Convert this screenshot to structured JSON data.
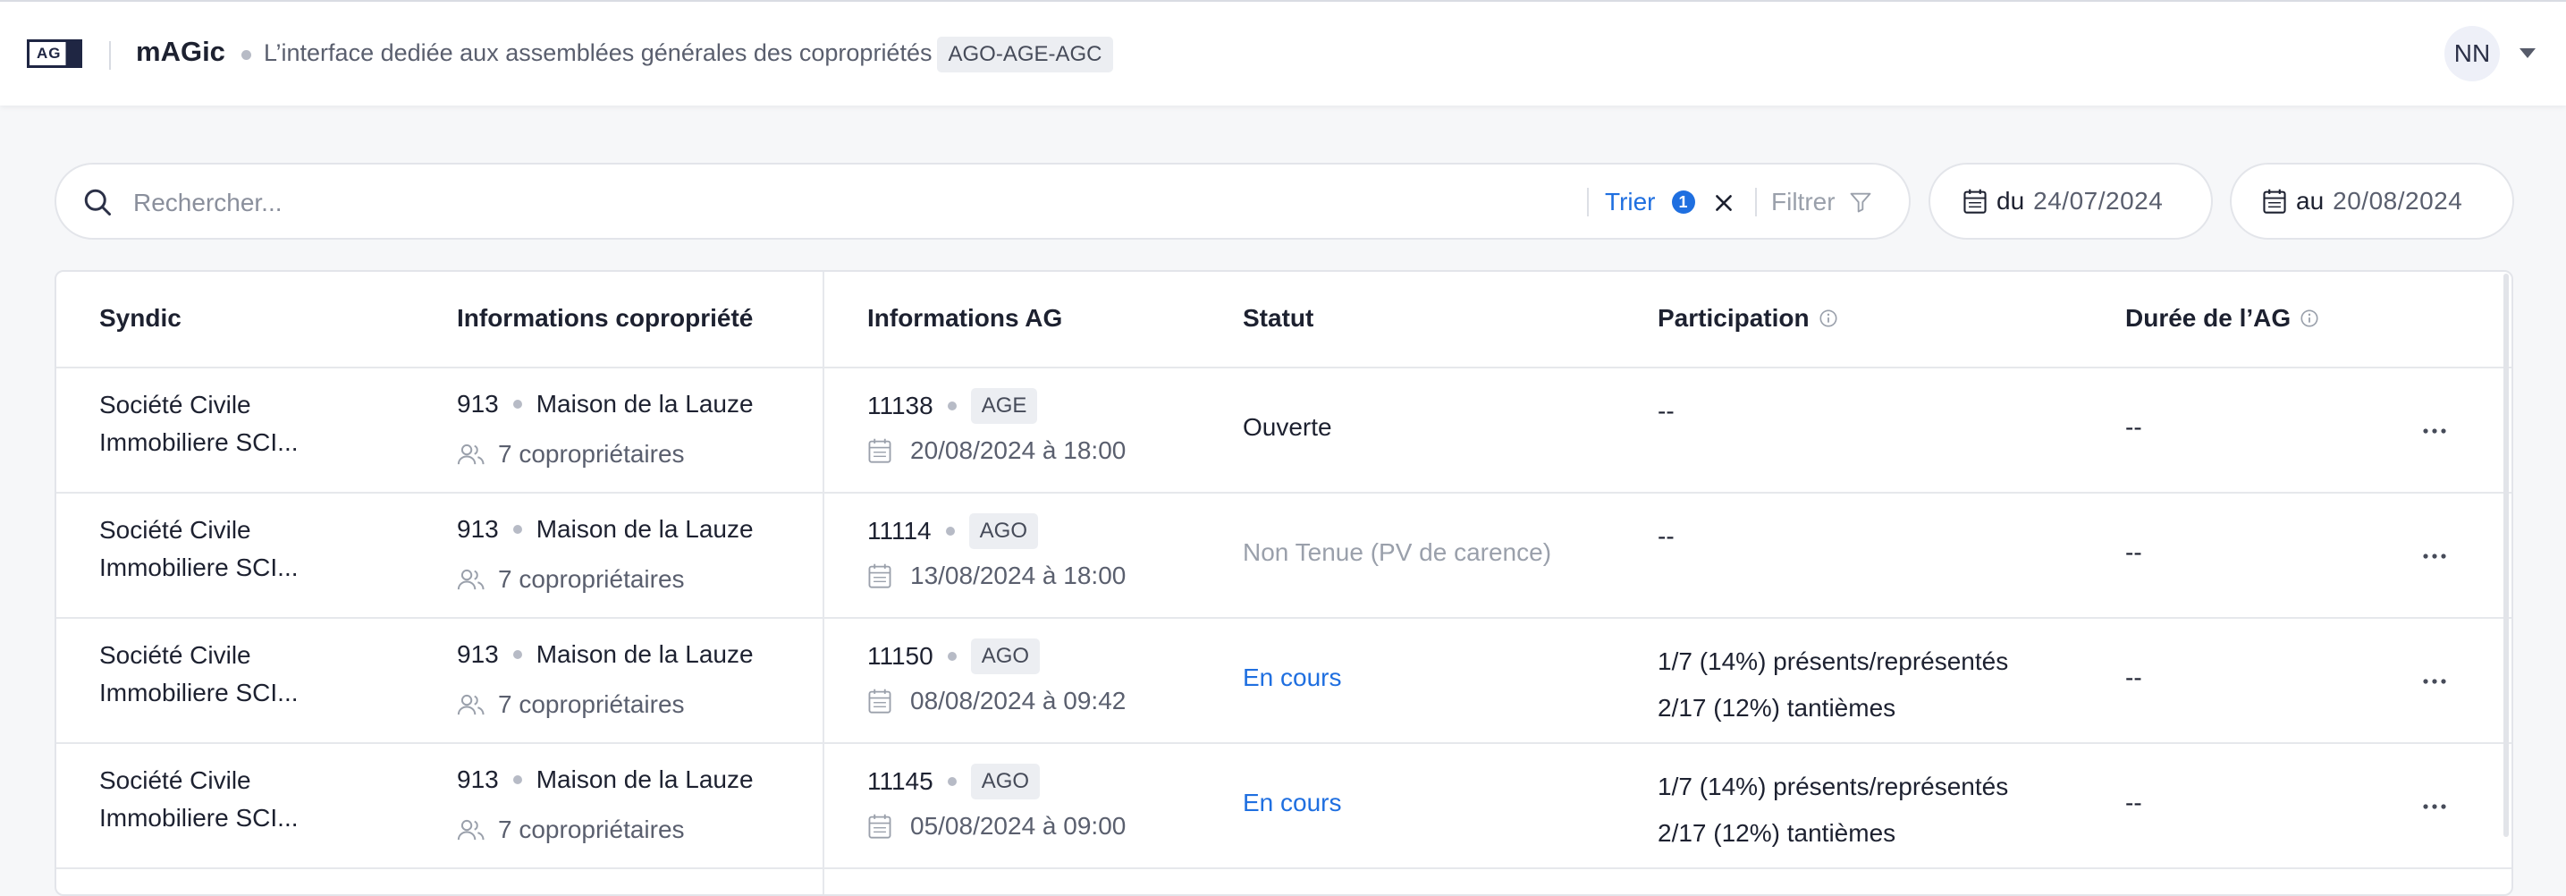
{
  "header": {
    "logo_text": "AG",
    "app_name": "mAGic",
    "tagline": "L’interface dediée aux assemblées générales des copropriétés",
    "types_badge": "AGO-AGE-AGC",
    "user_initials": "NN"
  },
  "toolbar": {
    "search_placeholder": "Rechercher...",
    "sort_label": "Trier",
    "sort_count": "1",
    "filter_label": "Filtrer",
    "date_from_label": "du",
    "date_from_value": "24/07/2024",
    "date_to_label": "au",
    "date_to_value": "20/08/2024"
  },
  "table": {
    "columns": [
      "Syndic",
      "Informations copropriété",
      "Informations AG",
      "Statut",
      "Participation",
      "Durée de l’AG"
    ],
    "rows": [
      {
        "syndic": "Société Civile Immobiliere SCI...",
        "copro_id": "913",
        "copro_name": "Maison de la Lauze",
        "copro_owners": "7 copropriétaires",
        "ag_id": "11138",
        "ag_type": "AGE",
        "ag_date": "20/08/2024 à 18:00",
        "statut": "Ouverte",
        "statut_color": "#1d2130",
        "participation_1": "--",
        "participation_2": "",
        "duree": "--"
      },
      {
        "syndic": "Société Civile Immobiliere SCI...",
        "copro_id": "913",
        "copro_name": "Maison de la Lauze",
        "copro_owners": "7 copropriétaires",
        "ag_id": "11114",
        "ag_type": "AGO",
        "ag_date": "13/08/2024 à 18:00",
        "statut": "Non Tenue (PV de carence)",
        "statut_color": "#9aa0ab",
        "participation_1": "--",
        "participation_2": "",
        "duree": "--"
      },
      {
        "syndic": "Société Civile Immobiliere SCI...",
        "copro_id": "913",
        "copro_name": "Maison de la Lauze",
        "copro_owners": "7 copropriétaires",
        "ag_id": "11150",
        "ag_type": "AGO",
        "ag_date": "08/08/2024 à 09:42",
        "statut": "En cours",
        "statut_color": "#1f6fe0",
        "participation_1": "1/7 (14%) présents/représentés",
        "participation_2": "2/17 (12%) tantièmes",
        "duree": "--"
      },
      {
        "syndic": "Société Civile Immobiliere SCI...",
        "copro_id": "913",
        "copro_name": "Maison de la Lauze",
        "copro_owners": "7 copropriétaires",
        "ag_id": "11145",
        "ag_type": "AGO",
        "ag_date": "05/08/2024 à 09:00",
        "statut": "En cours",
        "statut_color": "#1f6fe0",
        "participation_1": "1/7 (14%) présents/représentés",
        "participation_2": "2/17 (12%) tantièmes",
        "duree": "--"
      }
    ]
  },
  "colors": {
    "accent": "#1f6fe0",
    "brand_dark": "#1f2643",
    "muted_text": "#9aa0ab"
  },
  "icons": [
    "search-icon",
    "clear-icon",
    "filter-icon",
    "calendar-icon",
    "info-icon",
    "users-icon",
    "more-icon",
    "chevron-down-icon"
  ]
}
